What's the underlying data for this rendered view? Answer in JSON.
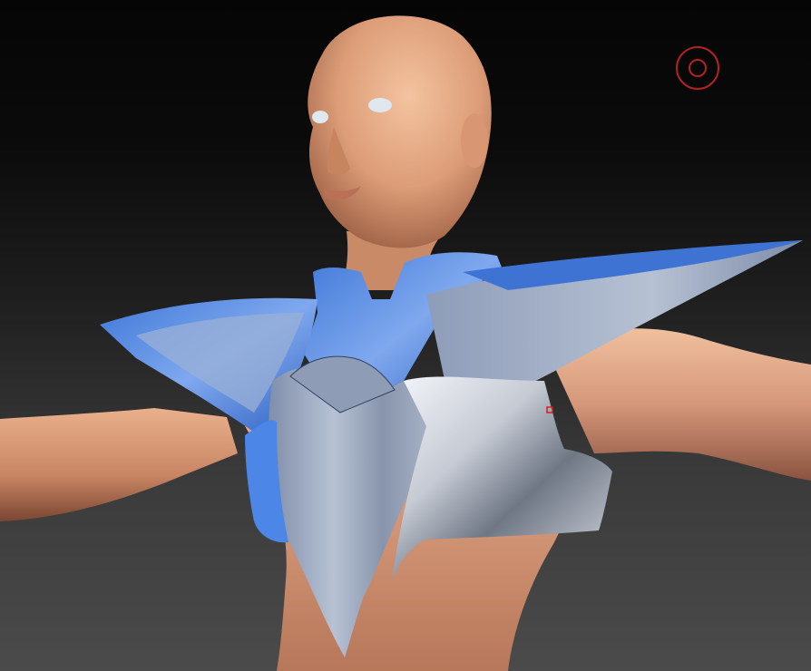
{
  "viewport": {
    "background_top": "#050505",
    "background_bottom": "#4b4b4b"
  },
  "colors": {
    "skin_light": "#f0b891",
    "skin_mid": "#d99a74",
    "skin_dark": "#9a5e43",
    "armor_blue": "#5b8fe0",
    "armor_steel": "#9aa8bf",
    "armor_highlight": "#eef2f8",
    "armor_dark": "#2a3a5c",
    "eye_white": "#dfe8ee",
    "brush_cursor": "#b22222",
    "vertex_marker": "#cc2222"
  },
  "icons": {
    "brush_cursor": "draw-brush-cursor-icon"
  }
}
